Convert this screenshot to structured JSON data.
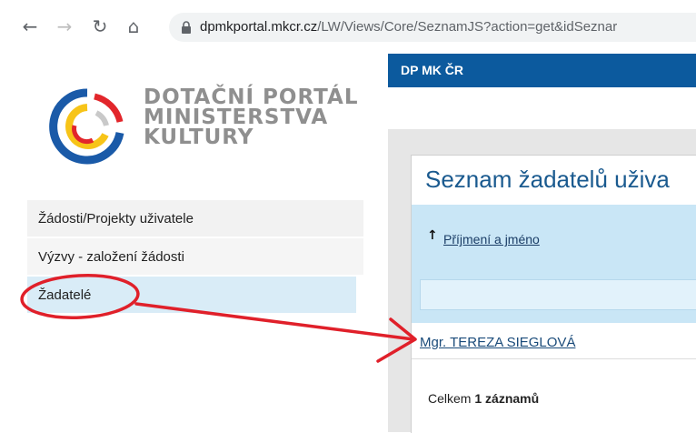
{
  "browser": {
    "url_host": "dpmkportal.mkcr.cz",
    "url_path": "/LW/Views/Core/SeznamJS?action=get&idSeznar",
    "back_icon": "arrow-left-icon",
    "forward_icon": "arrow-right-icon",
    "reload_icon": "reload-icon",
    "home_icon": "home-icon",
    "lock_icon": "lock-icon"
  },
  "logo": {
    "line1": "DOTAČNÍ PORTÁL",
    "line2": "MINISTERSTVA",
    "line3": "KULTURY"
  },
  "sidebar": {
    "items": [
      {
        "label": "Žádosti/Projekty uživatele"
      },
      {
        "label": "Výzvy - založení žádosti"
      },
      {
        "label": "Žadatelé"
      }
    ]
  },
  "topbar": {
    "title": "DP MK ČR"
  },
  "main": {
    "title": "Seznam žadatelů uživa",
    "sort_label": "Příjmení a jméno",
    "rows": [
      {
        "name": "Mgr. TEREZA SIEGLOVÁ"
      }
    ],
    "total_prefix": "Celkem ",
    "total_count": "1 záznamů"
  },
  "colors": {
    "topbar": "#0c5a9e",
    "selected_nav": "#d9ecf7",
    "header_band": "#c9e6f6",
    "annotation": "#e0202a"
  }
}
